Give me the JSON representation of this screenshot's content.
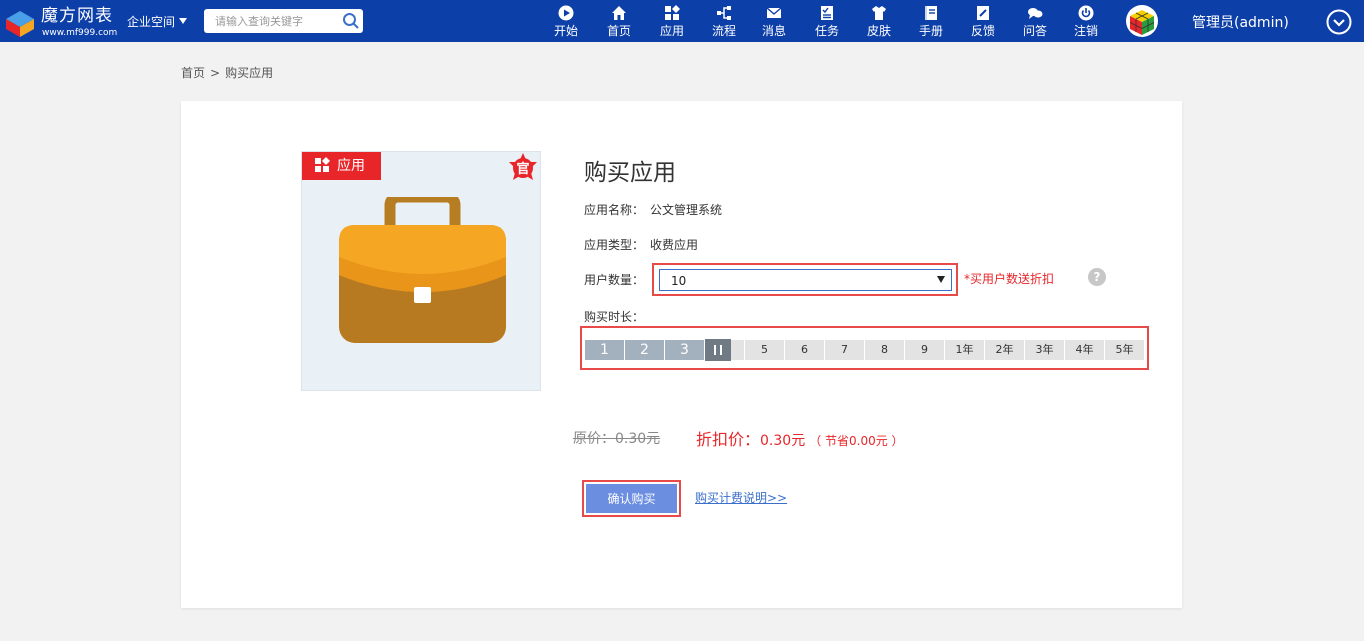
{
  "header": {
    "logo_title": "魔方网表",
    "logo_url": "www.mf999.com",
    "enterprise_label": "企业空间",
    "search_placeholder": "请输入查询关键字",
    "nav": [
      {
        "label": "开始",
        "icon": "play-icon"
      },
      {
        "label": "首页",
        "icon": "home-icon"
      },
      {
        "label": "应用",
        "icon": "apps-icon"
      },
      {
        "label": "流程",
        "icon": "flow-icon"
      },
      {
        "label": "消息",
        "icon": "mail-icon"
      },
      {
        "label": "任务",
        "icon": "task-icon"
      },
      {
        "label": "皮肤",
        "icon": "shirt-icon"
      },
      {
        "label": "手册",
        "icon": "manual-icon"
      },
      {
        "label": "反馈",
        "icon": "feedback-icon"
      },
      {
        "label": "问答",
        "icon": "qa-icon"
      },
      {
        "label": "注销",
        "icon": "power-icon"
      }
    ],
    "user_name": "管理员(admin)"
  },
  "breadcrumb": {
    "home": "首页",
    "separator": ">",
    "current": "购买应用"
  },
  "app_card": {
    "tag_label": "应用",
    "official_badge": "官",
    "title": "购买应用",
    "name_label": "应用名称：",
    "name_value": "公文管理系统",
    "type_label": "应用类型：",
    "type_value": "收费应用",
    "user_count_label": "用户数量：",
    "user_count_value": "10",
    "discount_note": "*买用户数送折扣",
    "help": "?",
    "duration_label": "购买时长：",
    "duration_options": [
      "1",
      "2",
      "3",
      "4",
      "5",
      "6",
      "7",
      "8",
      "9",
      "1年",
      "2年",
      "3年",
      "4年",
      "5年"
    ],
    "duration_selected": 4,
    "original_price": "原价：0.30元",
    "discount_price_label": "折扣价：",
    "discount_price_value": "0.30元",
    "saved_text": "（ 节省0.00元 ）",
    "confirm_button": "确认购买",
    "pricing_link": "购买计费说明>>"
  },
  "colors": {
    "header_bg": "#0d3fa8",
    "accent_red": "#e8262a",
    "button_blue": "#6b8ee0",
    "link_blue": "#3a6fcc"
  }
}
